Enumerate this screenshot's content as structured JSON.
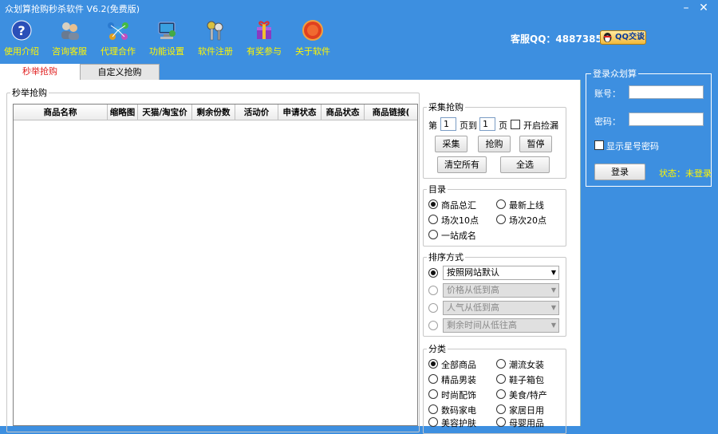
{
  "window": {
    "title": "众划算抢购秒杀软件 V6.2(免费版)",
    "minimize": "–",
    "close": "✕"
  },
  "toolbar": [
    {
      "label": "使用介绍",
      "icon": "help-icon"
    },
    {
      "label": "咨询客服",
      "icon": "users-icon"
    },
    {
      "label": "代理合作",
      "icon": "network-icon"
    },
    {
      "label": "功能设置",
      "icon": "computer-settings-icon"
    },
    {
      "label": "软件注册",
      "icon": "keys-icon"
    },
    {
      "label": "有奖参与",
      "icon": "gift-icon"
    },
    {
      "label": "关于软件",
      "icon": "about-badge-icon"
    }
  ],
  "header": {
    "kefu": "客服QQ：488738580",
    "qq_button": "QQ交谈"
  },
  "tabs": [
    "秒举抢购",
    "自定义抢购"
  ],
  "main": {
    "group_label": "秒举抢购",
    "columns": [
      "商品名称",
      "缩略图",
      "天猫/淘宝价",
      "剩余份数",
      "活动价",
      "申请状态",
      "商品状态",
      "商品链接("
    ]
  },
  "collect": {
    "legend": "采集抢购",
    "di": "第",
    "page_from": "1",
    "to": "页到",
    "page_to": "1",
    "ye": "页",
    "start_pick": "开启捡漏",
    "btn_collect": "采集",
    "btn_grab": "抢购",
    "btn_pause": "暂停",
    "btn_clear": "清空所有",
    "btn_select_all": "全选"
  },
  "catalog": {
    "legend": "目录",
    "options": [
      "商品总汇",
      "最新上线",
      "场次10点",
      "场次20点",
      "一站成名"
    ],
    "selected": "商品总汇"
  },
  "sort": {
    "legend": "排序方式",
    "options": [
      "按照网站默认",
      "价格从低到高",
      "人气从低到高",
      "剩余时间从低往高"
    ],
    "selected": "按照网站默认"
  },
  "category": {
    "legend": "分类",
    "options": [
      "全部商品",
      "潮流女装",
      "精品男装",
      "鞋子箱包",
      "时尚配饰",
      "美食/特产",
      "数码家电",
      "家居日用",
      "美容护肤",
      "母婴用品"
    ],
    "selected": "全部商品"
  },
  "login": {
    "legend": "登录众划算",
    "account_label": "账号：",
    "password_label": "密码：",
    "show_password": "显示星号密码",
    "login_button": "登录",
    "status": "状态：未登录"
  },
  "colors": {
    "background": "#3d8fe0",
    "toolbar_text": "#fff600",
    "active_tab_text": "#e02020",
    "status_text": "#fff600"
  }
}
